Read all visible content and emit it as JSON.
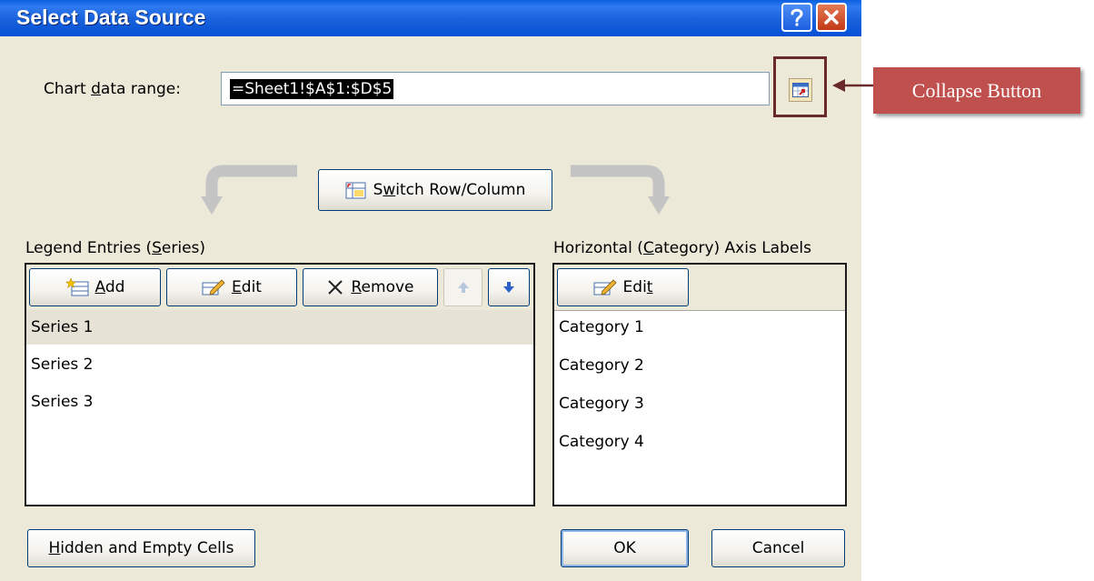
{
  "dialog": {
    "title": "Select Data Source",
    "help_icon": "question-mark-icon",
    "close_icon": "close-x-icon"
  },
  "range": {
    "label_pre": "Chart ",
    "label_ul": "d",
    "label_post": "ata range:",
    "value": "=Sheet1!$A$1:$D$5"
  },
  "collapse_icon": "collapse-range-icon",
  "switch": {
    "pre": "S",
    "ul": "w",
    "post": "itch Row/Column",
    "icon": "switch-row-column-icon"
  },
  "legend": {
    "label_pre": "Legend Entries (",
    "label_ul": "S",
    "label_post": "eries)",
    "add": {
      "ul": "A",
      "post": "dd",
      "icon": "add-series-icon"
    },
    "edit": {
      "ul": "E",
      "post": "dit",
      "icon": "edit-pencil-icon"
    },
    "remove": {
      "ul": "R",
      "post": "emove",
      "icon": "remove-x-icon"
    },
    "move_up_icon": "arrow-up-icon",
    "move_down_icon": "arrow-down-icon",
    "series": [
      "Series 1",
      "Series 2",
      "Series 3"
    ],
    "selected_index": 0
  },
  "axis": {
    "label_pre": "Horizontal (",
    "label_ul": "C",
    "label_post": "ategory) Axis Labels",
    "edit": {
      "pre": "Edi",
      "ul": "t",
      "icon": "edit-pencil-icon"
    },
    "categories": [
      "Category 1",
      "Category 2",
      "Category 3",
      "Category 4"
    ]
  },
  "footer": {
    "hidden": {
      "ul": "H",
      "post": "idden and Empty Cells"
    },
    "ok": "OK",
    "cancel": "Cancel"
  },
  "annotation": {
    "text": "Collapse Button",
    "color": "#c0504d"
  }
}
